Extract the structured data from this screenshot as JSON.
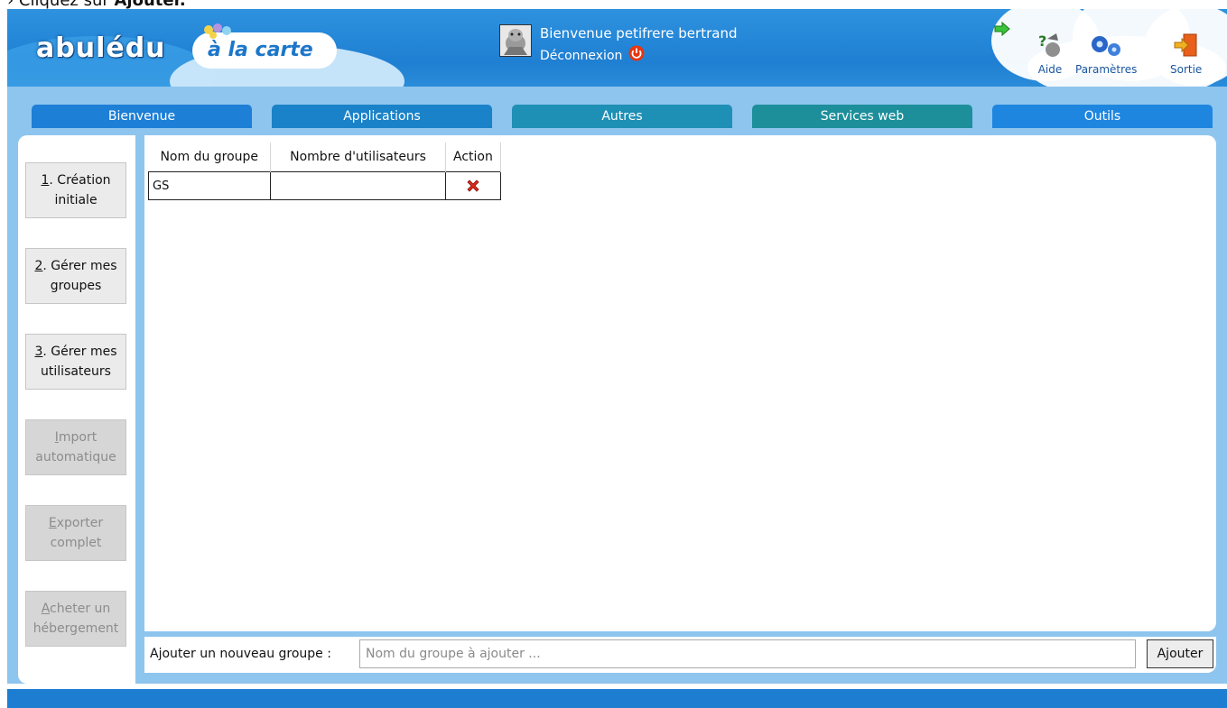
{
  "instruction": {
    "prefix": "› Cliquez sur ",
    "bold": "Ajouter."
  },
  "header": {
    "logo": "abulédu",
    "tagline": "à la carte",
    "welcome": "Bienvenue petifrere bertrand",
    "logout": "Déconnexion",
    "tools": [
      {
        "label": "Aide",
        "icon": "help-icon"
      },
      {
        "label": "Paramètres",
        "icon": "gears-icon"
      },
      {
        "label": "Sortie",
        "icon": "exit-icon"
      }
    ]
  },
  "tabs": [
    {
      "label": "Bienvenue",
      "color": "#1d7fd6"
    },
    {
      "label": "Applications",
      "color": "#1a82c8"
    },
    {
      "label": "Autres",
      "color": "#1e8fb5"
    },
    {
      "label": "Services web",
      "color": "#1c8f9b"
    },
    {
      "label": "Outils",
      "color": "#1f86e0"
    }
  ],
  "sidebar": {
    "items": [
      {
        "key": "1",
        "rest": ". Création initiale",
        "disabled": false
      },
      {
        "key": "2",
        "rest": ". Gérer mes groupes",
        "disabled": false
      },
      {
        "key": "3",
        "rest": ". Gérer mes utilisateurs",
        "disabled": false
      },
      {
        "key": "I",
        "rest": "mport automatique",
        "disabled": true
      },
      {
        "key": "E",
        "rest": "xporter complet",
        "disabled": true
      },
      {
        "key": "A",
        "rest": "cheter un hébergement",
        "disabled": true
      }
    ]
  },
  "table": {
    "headers": [
      "Nom du groupe",
      "Nombre d'utilisateurs",
      "Action"
    ],
    "rows": [
      {
        "name": "GS",
        "count": "",
        "action_icon": "delete-icon"
      }
    ]
  },
  "add_group": {
    "label": "Ajouter un nouveau groupe :",
    "placeholder": "Nom du groupe à ajouter ...",
    "button": "Ajouter"
  }
}
